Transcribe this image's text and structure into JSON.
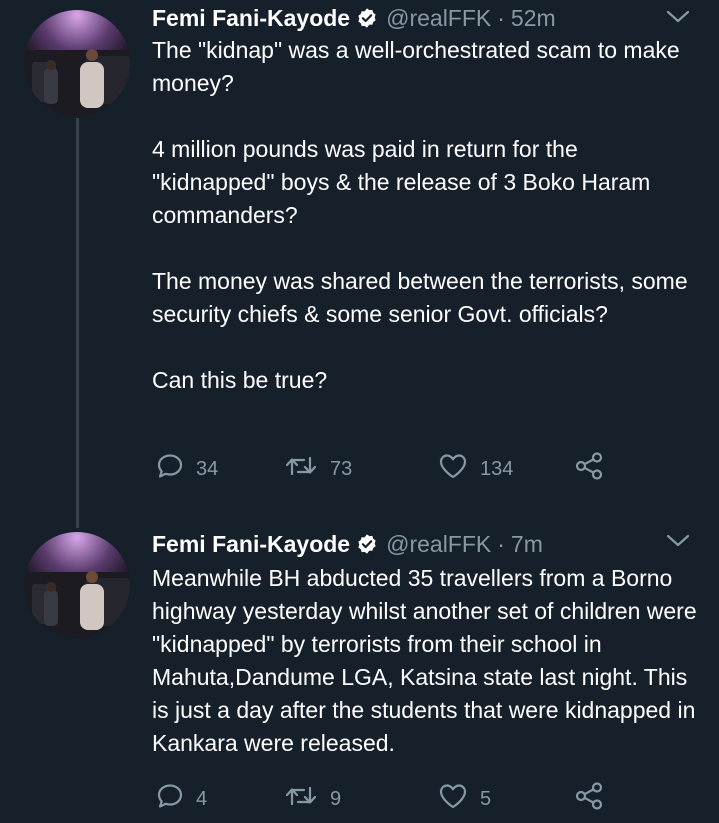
{
  "tweets": [
    {
      "author": {
        "display_name": "Femi Fani-Kayode",
        "handle": "@realFFK",
        "verified": true
      },
      "separator": "·",
      "time": "52m",
      "paragraphs": [
        "The \"kidnap\" was a well-orchestrated scam to make money?",
        "4 million pounds was paid in return for the \"kidnapped\" boys & the release of 3 Boko Haram commanders?",
        "The money was shared between the terrorists, some security chiefs & some senior Govt. officials?",
        "Can this be true?"
      ],
      "stats": {
        "replies": "34",
        "retweets": "73",
        "likes": "134"
      }
    },
    {
      "author": {
        "display_name": "Femi Fani-Kayode",
        "handle": "@realFFK",
        "verified": true
      },
      "separator": "·",
      "time": "7m",
      "paragraphs": [
        "Meanwhile BH abducted 35 travellers from a Borno highway yesterday whilst another set of children were \"kidnapped\" by terrorists from their school in Mahuta,Dandume LGA, Katsina state last night. This is just a day after the students that were kidnapped in Kankara were released."
      ],
      "stats": {
        "replies": "4",
        "retweets": "9",
        "likes": "5"
      }
    }
  ],
  "icons": {
    "verified": "verified-badge-icon",
    "more": "chevron-down-icon",
    "reply": "reply-icon",
    "retweet": "retweet-icon",
    "like": "heart-icon",
    "share": "share-icon"
  },
  "colors": {
    "background": "#15202b",
    "text": "#ffffff",
    "muted": "#8899a6",
    "thread_line": "#38444d"
  }
}
